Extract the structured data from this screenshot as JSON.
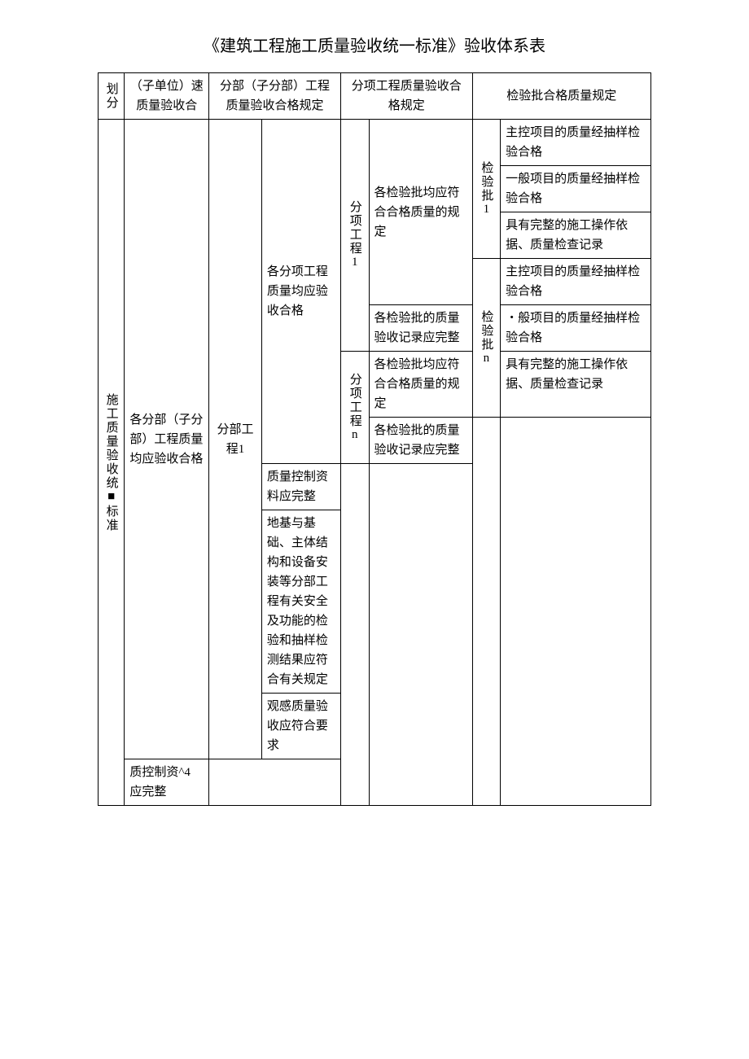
{
  "title": "《建筑工程施工质量验收统一标准》验收体系表",
  "header": {
    "col1": "划分",
    "col2": "（子单位）速质量验收合",
    "col3": "分部（子分部）工程质量验收合格规定",
    "col4": "分项工程质量验收合格规定",
    "col5": "检验批合格质量规定"
  },
  "body": {
    "row_label": "施工质量验收统■标准",
    "col2_r1": "各分部（子分部）工程质量均应验收合格",
    "col2_r2": "质控制资^4 应完整",
    "col3_lvl1": "分部工程1",
    "col3_item1": "各分项工程质量均应验收合格",
    "col3_item2": "质量控制资料应完整",
    "col3_item3": "地基与基础、主体结构和设备安装等分部工程有关安全及功能的检验和抽样检测结果应符合有关规定",
    "col3_item4": "观感质量验收应符合要求",
    "col4_sub1": "分项工程1",
    "col4_sub1_item1": "各检验批均应符合合格质量的规定",
    "col4_sub1_item2": "各检验批的质量验收记录应完整",
    "col4_sub2": "分项工程n",
    "col4_sub2_item1": "各检验批均应符合合格质量的规定",
    "col4_sub2_item2": "各检验批的质量验收记录应完整",
    "col5_sub1": "检验批1",
    "col5_sub1_item1": "主控项目的质量经抽样检验合格",
    "col5_sub1_item2": "一般项目的质量经抽样检验合格",
    "col5_sub1_item3": "具有完整的施工操作依据、质量检查记录",
    "col5_sub2": "检验批n",
    "col5_sub2_item1": "主控项目的质量经抽样检验合格",
    "col5_sub2_item2": "・般项目的质量经抽样检验合格",
    "col5_sub2_item3": "具有完整的施工操作依据、质量检查记录"
  }
}
